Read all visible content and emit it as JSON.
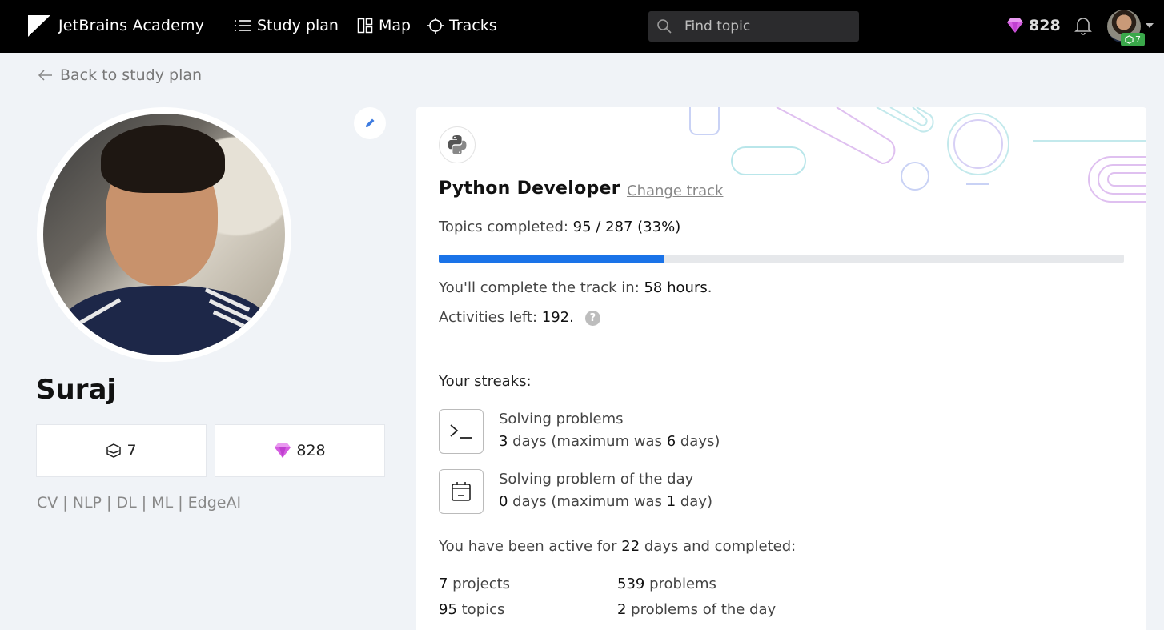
{
  "nav": {
    "brand": "JetBrains Academy",
    "items": [
      {
        "label": "Study plan",
        "icon": "list-icon"
      },
      {
        "label": "Map",
        "icon": "map-icon"
      },
      {
        "label": "Tracks",
        "icon": "tracks-icon"
      }
    ],
    "search_placeholder": "Find topic",
    "gems": "828",
    "level_badge": "7"
  },
  "back_link": "Back to study plan",
  "profile": {
    "name": "Suraj",
    "level": "7",
    "gems": "828",
    "bio": "CV | NLP | DL | ML | EdgeAI"
  },
  "track": {
    "name": "Python Developer",
    "change_label": "Change track",
    "topics_label": "Topics completed: ",
    "topics_value": "95 / 287 (33%)",
    "progress_percent": 33,
    "complete_label": "You'll complete the track in: ",
    "complete_value": "58 hours",
    "complete_suffix": ".",
    "activities_label": "Activities left: ",
    "activities_value": "192.",
    "help_glyph": "?"
  },
  "streaks": {
    "heading": "Your streaks:",
    "items": [
      {
        "title": "Solving problems",
        "current": "3",
        "text_mid": " days (maximum was ",
        "max": "6",
        "text_end": " days)",
        "icon": "terminal-icon"
      },
      {
        "title": "Solving problem of the day",
        "current": "0",
        "text_mid": " days (maximum was ",
        "max": "1",
        "text_end": " day)",
        "icon": "calendar-icon"
      }
    ]
  },
  "activity": {
    "prefix": "You have been active for ",
    "days": "22",
    "suffix": " days and completed:",
    "totals": [
      {
        "value": "7",
        "label": " projects"
      },
      {
        "value": "539",
        "label": " problems"
      },
      {
        "value": "95",
        "label": " topics"
      },
      {
        "value": "2",
        "label": " problems of the day"
      }
    ]
  },
  "colors": {
    "accent": "#1a73e8",
    "gem": "#d45de0",
    "level_badge": "#3aa84a"
  }
}
